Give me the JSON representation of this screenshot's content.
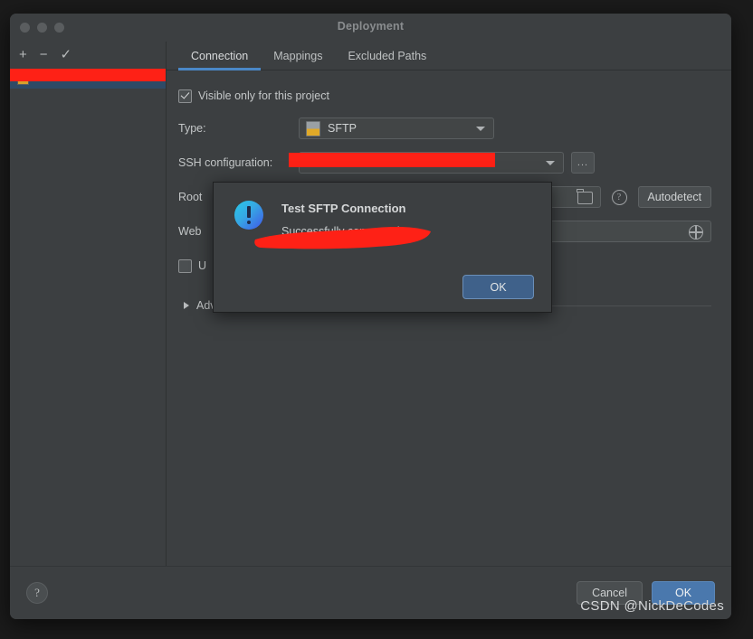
{
  "window": {
    "title": "Deployment",
    "traffic_lights": [
      "close-light",
      "minimize-light",
      "zoom-light"
    ]
  },
  "sidebar": {
    "toolbar": [
      {
        "name": "add",
        "glyph": "+"
      },
      {
        "name": "remove",
        "glyph": "−"
      },
      {
        "name": "apply-check",
        "glyph": "✓"
      }
    ],
    "items": [
      {
        "label": "",
        "redacted": true,
        "selected": true
      }
    ]
  },
  "tabs": [
    {
      "label": "Connection",
      "active": true
    },
    {
      "label": "Mappings",
      "active": false
    },
    {
      "label": "Excluded Paths",
      "active": false
    }
  ],
  "form": {
    "visible_only_checkbox": {
      "label": "Visible only for this project",
      "checked": true
    },
    "type": {
      "label": "Type:",
      "value": "SFTP",
      "icon": "sftp-icon"
    },
    "ssh_configuration": {
      "label": "SSH configuration:",
      "value": "",
      "redacted": true,
      "browse_label": "..."
    },
    "root_path": {
      "label": "Root",
      "value": "",
      "autodetect_label": "Autodetect",
      "folder_icon": "folder-icon",
      "help_icon": "help-icon"
    },
    "web_path": {
      "label": "Web",
      "value": "",
      "globe_icon": "globe-icon"
    },
    "extra_checkbox": {
      "label": "U",
      "checked": false
    },
    "advanced": {
      "label": "Advanced",
      "expanded": false
    }
  },
  "footer": {
    "help_glyph": "?",
    "cancel_label": "Cancel",
    "ok_label": "OK"
  },
  "dialog": {
    "title": "Test SFTP Connection",
    "message_line1": "Successfully connected to",
    "message_line2": "",
    "ok_label": "OK",
    "icon": "info-exclamation-icon"
  },
  "watermark": "CSDN @NickDeCodes",
  "colors": {
    "window_bg": "#3c3f41",
    "accent_tab": "#4a88c7",
    "ok_button": "#4a78ad",
    "dialog_ok": "#3f618a",
    "selection": "#2e4a66",
    "redaction": "#fe2116"
  }
}
